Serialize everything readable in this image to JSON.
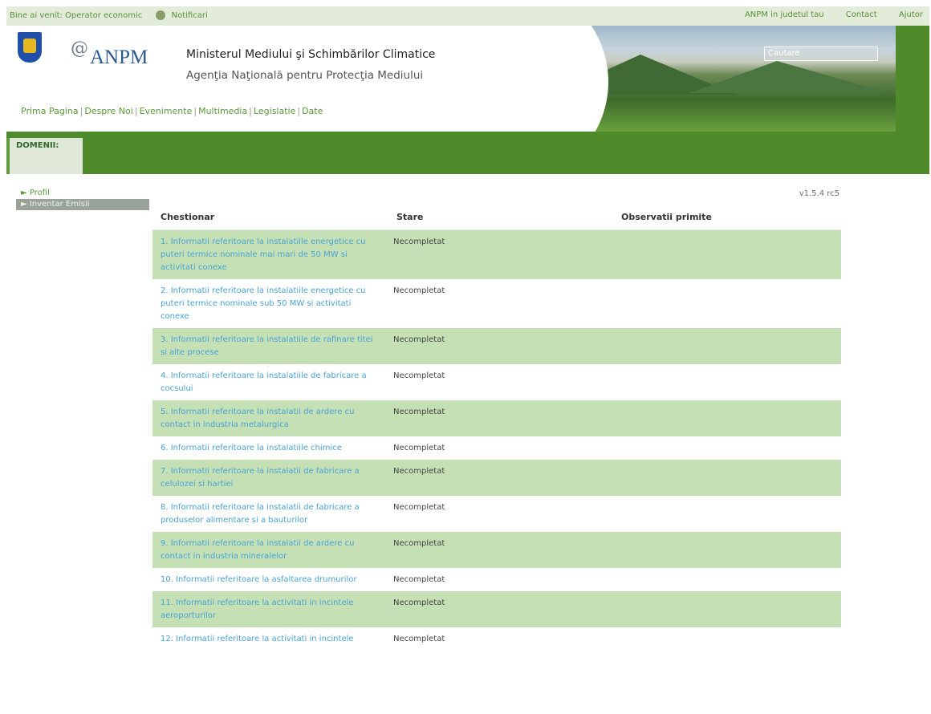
{
  "topbar": {
    "welcome": "Bine ai venit: Operator economic",
    "notifications": "Notificari",
    "anpm_judet": "ANPM in judetul tau",
    "contact": "Contact",
    "help": "Ajutor"
  },
  "header": {
    "logo_text": "ANPM",
    "ministry": "Ministerul Mediului şi Schimbărilor Climatice",
    "agency": "Agenţia Naţională pentru Protecţia Mediului",
    "search_value": "Cautare"
  },
  "nav": [
    "Prima Pagina",
    "Despre Noi",
    "Evenimente",
    "Multimedia",
    "Legislatie",
    "Date"
  ],
  "domenii_label": "DOMENII:",
  "sidebar": [
    {
      "label": "► Profil",
      "active": false
    },
    {
      "label": "► Inventar Emisii",
      "active": true
    }
  ],
  "version": "v1.5.4 rc5",
  "table": {
    "headers": [
      "Chestionar",
      "Stare",
      "Observatii primite"
    ],
    "rows": [
      {
        "q": "1. Informatii referitoare la instalatiile energetice cu puteri termice nominale mai mari de 50 MW si activitati conexe",
        "s": "Necompletat",
        "o": ""
      },
      {
        "q": "2. Informatii referitoare la instalatiile energetice cu puteri termice nominale sub 50 MW si activitati conexe",
        "s": "Necompletat",
        "o": ""
      },
      {
        "q": "3. Informatii referitoare la instalatiile de rafinare titei si alte procese",
        "s": "Necompletat",
        "o": ""
      },
      {
        "q": "4. Informatii referitoare la instalatiile de fabricare a cocsului",
        "s": "Necompletat",
        "o": ""
      },
      {
        "q": "5. Informatii referitoare la instalatii de ardere cu contact in industria metalurgica",
        "s": "Necompletat",
        "o": ""
      },
      {
        "q": "6. Informatii referitoare la instalatiile chimice",
        "s": "Necompletat",
        "o": ""
      },
      {
        "q": "7. Informatii referitoare la instalatii de fabricare a celulozei si hartiei",
        "s": "Necompletat",
        "o": ""
      },
      {
        "q": "8. Informatii referitoare la instalatii de fabricare a produselor alimentare si a bauturilor",
        "s": "Necompletat",
        "o": ""
      },
      {
        "q": "9. Informatii referitoare la instalatii de ardere cu contact in industria mineralelor",
        "s": "Necompletat",
        "o": ""
      },
      {
        "q": "10. Informatii referitoare la asfaltarea drumurilor",
        "s": "Necompletat",
        "o": ""
      },
      {
        "q": "11. Informatii referitoare la activitati in incintele aeroporturilor",
        "s": "Necompletat",
        "o": ""
      },
      {
        "q": "12. Informatii referitoare la activitati in incintele",
        "s": "Necompletat",
        "o": ""
      }
    ]
  }
}
